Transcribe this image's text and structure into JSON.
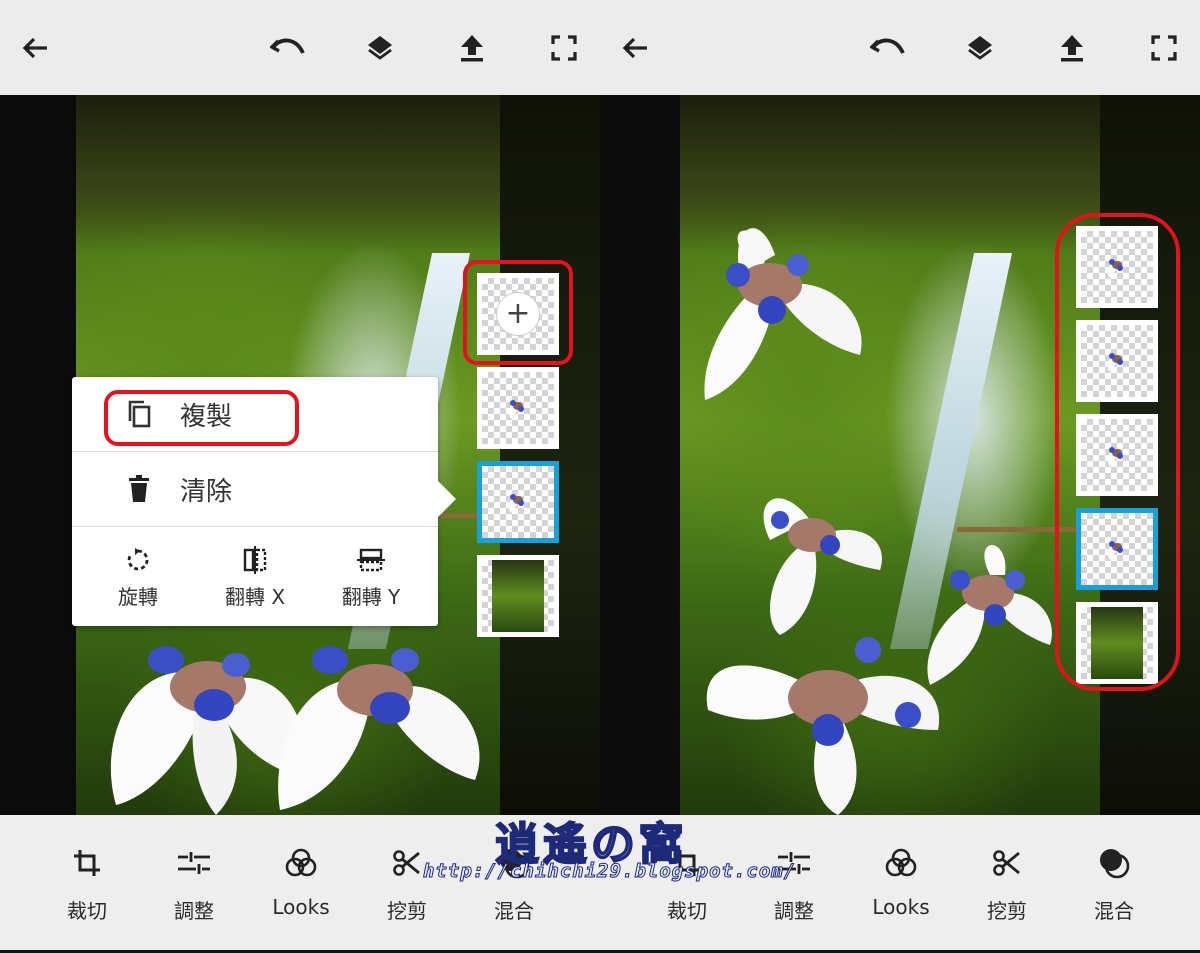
{
  "left_panel": {
    "context_menu": {
      "copy_label": "複製",
      "clear_label": "清除",
      "actions": [
        {
          "label": "旋轉",
          "icon": "rotate-icon"
        },
        {
          "label": "翻轉 X",
          "icon": "flip-x-icon"
        },
        {
          "label": "翻轉 Y",
          "icon": "flip-y-icon"
        }
      ]
    },
    "layers": [
      {
        "type": "add",
        "icon": "plus-icon"
      },
      {
        "type": "flower-layer"
      },
      {
        "type": "flower-layer",
        "selected": true
      },
      {
        "type": "background-layer"
      }
    ]
  },
  "right_panel": {
    "layers": [
      {
        "type": "flower-layer"
      },
      {
        "type": "flower-layer"
      },
      {
        "type": "flower-layer"
      },
      {
        "type": "flower-layer",
        "selected": true
      },
      {
        "type": "background-layer"
      }
    ]
  },
  "topbar_icons": [
    "back-arrow-icon",
    "undo-icon",
    "layers-icon",
    "upload-icon",
    "fullscreen-icon"
  ],
  "toolbar": {
    "crop": "裁切",
    "adjust": "調整",
    "looks": "Looks",
    "cutout": "挖剪",
    "blend": "混合"
  },
  "watermark": {
    "title": "逍遙の窩",
    "url": "http://chihchi29.blogspot.com/"
  },
  "colors": {
    "highlight_red": "#e3121c",
    "selected_blue": "#1aa0d8",
    "bar_gray": "#ececec"
  }
}
